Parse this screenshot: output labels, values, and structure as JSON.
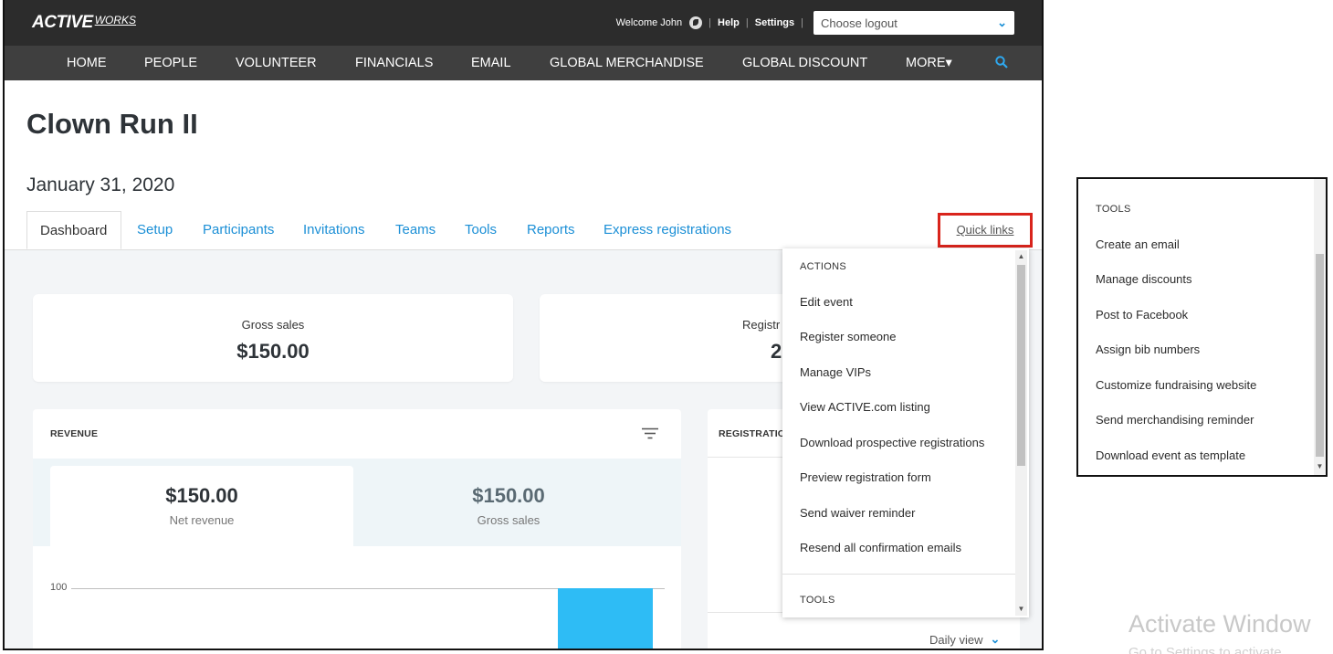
{
  "header": {
    "logo_main": "ACTIVE",
    "logo_sub": "WORKS",
    "welcome": "Welcome John",
    "help": "Help",
    "settings": "Settings",
    "logout_select": "Choose logout"
  },
  "nav": {
    "items": [
      "HOME",
      "PEOPLE",
      "VOLUNTEER",
      "FINANCIALS",
      "EMAIL",
      "GLOBAL MERCHANDISE",
      "GLOBAL DISCOUNT",
      "MORE▾"
    ]
  },
  "page": {
    "title": "Clown Run II",
    "date": "January 31, 2020",
    "quick_links": "Quick links"
  },
  "tabs": [
    "Dashboard",
    "Setup",
    "Participants",
    "Invitations",
    "Teams",
    "Tools",
    "Reports",
    "Express registrations"
  ],
  "summary": {
    "gross_label": "Gross sales",
    "gross_value": "$150.00",
    "reg_label": "Registr",
    "reg_value": "2"
  },
  "revenue": {
    "title": "REVENUE",
    "net_value": "$150.00",
    "net_label": "Net revenue",
    "gross_value": "$150.00",
    "gross_label": "Gross sales",
    "axis_tick": "100"
  },
  "registrations": {
    "title": "REGISTRATIO",
    "view": "Daily view"
  },
  "quick_menu": {
    "actions_header": "ACTIONS",
    "actions": [
      "Edit event",
      "Register someone",
      "Manage VIPs",
      "View ACTIVE.com listing",
      "Download prospective registrations",
      "Preview registration form",
      "Send waiver reminder",
      "Resend all confirmation emails"
    ],
    "tools_header": "TOOLS"
  },
  "side_menu": {
    "tools_header": "TOOLS",
    "tools": [
      "Create an email",
      "Manage discounts",
      "Post to Facebook",
      "Assign bib numbers",
      "Customize fundraising website",
      "Send merchandising reminder",
      "Download event as template"
    ]
  },
  "watermark": {
    "line1": "Activate Window",
    "line2": "Go to Settings to activate"
  },
  "colors": {
    "accent": "#1b8fd6",
    "highlight": "#d9241c",
    "bar": "#2ebcf5",
    "topbar": "#2c2c2c",
    "navbar": "#3f3f3f"
  },
  "icons": [
    "globe-icon",
    "chevron-down-icon",
    "search-icon",
    "filter-icon",
    "scroll-up-icon",
    "scroll-down-icon"
  ]
}
